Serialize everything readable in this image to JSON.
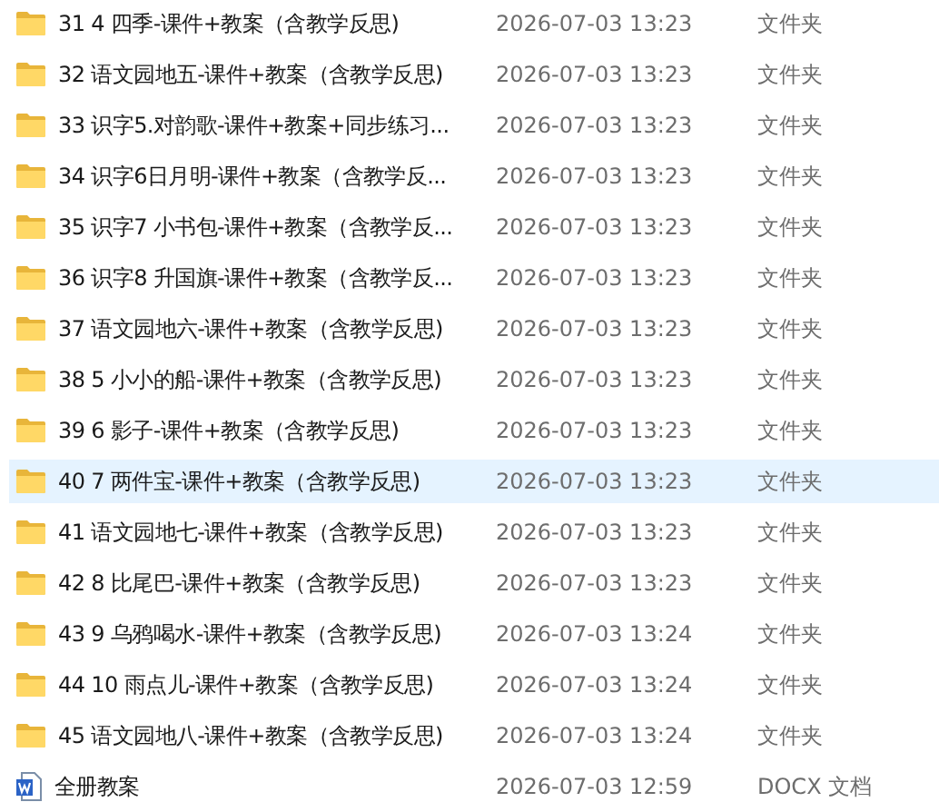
{
  "files": [
    {
      "kind": "folder",
      "name": "31 4 四季-课件+教案（含教学反思)",
      "modified": "2026-07-03 13:23",
      "type": "文件夹",
      "selected": false
    },
    {
      "kind": "folder",
      "name": "32 语文园地五-课件+教案（含教学反思)",
      "modified": "2026-07-03 13:23",
      "type": "文件夹",
      "selected": false
    },
    {
      "kind": "folder",
      "name": "33 识字5.对韵歌-课件+教案+同步练习...",
      "modified": "2026-07-03 13:23",
      "type": "文件夹",
      "selected": false
    },
    {
      "kind": "folder",
      "name": "34 识字6日月明-课件+教案（含教学反...",
      "modified": "2026-07-03 13:23",
      "type": "文件夹",
      "selected": false
    },
    {
      "kind": "folder",
      "name": "35 识字7 小书包-课件+教案（含教学反...",
      "modified": "2026-07-03 13:23",
      "type": "文件夹",
      "selected": false
    },
    {
      "kind": "folder",
      "name": "36 识字8 升国旗-课件+教案（含教学反...",
      "modified": "2026-07-03 13:23",
      "type": "文件夹",
      "selected": false
    },
    {
      "kind": "folder",
      "name": "37 语文园地六-课件+教案（含教学反思)",
      "modified": "2026-07-03 13:23",
      "type": "文件夹",
      "selected": false
    },
    {
      "kind": "folder",
      "name": "38 5 小小的船-课件+教案（含教学反思)",
      "modified": "2026-07-03 13:23",
      "type": "文件夹",
      "selected": false
    },
    {
      "kind": "folder",
      "name": "39 6 影子-课件+教案（含教学反思)",
      "modified": "2026-07-03 13:23",
      "type": "文件夹",
      "selected": false
    },
    {
      "kind": "folder",
      "name": "40 7 两件宝-课件+教案（含教学反思)",
      "modified": "2026-07-03 13:23",
      "type": "文件夹",
      "selected": true
    },
    {
      "kind": "folder",
      "name": "41 语文园地七-课件+教案（含教学反思)",
      "modified": "2026-07-03 13:23",
      "type": "文件夹",
      "selected": false
    },
    {
      "kind": "folder",
      "name": "42 8 比尾巴-课件+教案（含教学反思)",
      "modified": "2026-07-03 13:23",
      "type": "文件夹",
      "selected": false
    },
    {
      "kind": "folder",
      "name": "43 9 乌鸦喝水-课件+教案（含教学反思)",
      "modified": "2026-07-03 13:24",
      "type": "文件夹",
      "selected": false
    },
    {
      "kind": "folder",
      "name": "44 10 雨点儿-课件+教案（含教学反思)",
      "modified": "2026-07-03 13:24",
      "type": "文件夹",
      "selected": false
    },
    {
      "kind": "folder",
      "name": "45 语文园地八-课件+教案（含教学反思)",
      "modified": "2026-07-03 13:24",
      "type": "文件夹",
      "selected": false
    },
    {
      "kind": "docx",
      "name": "全册教案",
      "modified": "2026-07-03 12:59",
      "type": "DOCX 文档",
      "selected": false
    }
  ]
}
